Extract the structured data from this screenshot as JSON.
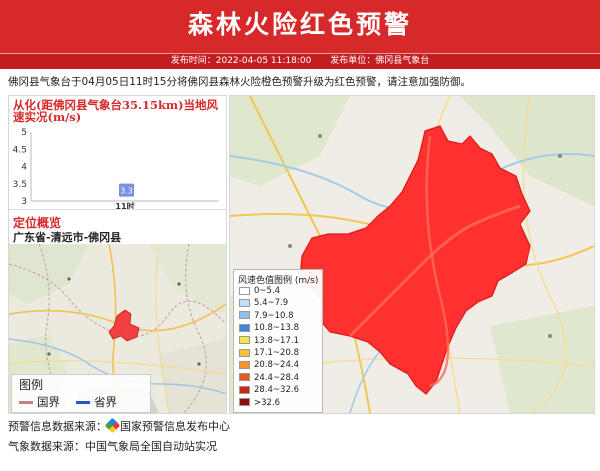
{
  "title": "森林火险红色预警",
  "meta": {
    "publish_time_label": "发布时间：2022-04-05 11:18:00",
    "publisher_label": "发布单位：佛冈县气象台"
  },
  "summary": "佛冈县气象台于04月05日11时15分将佛冈县森林火险橙色预警升级为红色预警，请注意加强防御。",
  "wind_panel": {
    "title": "从化(距佛冈县气象台35.15km)当地风速实况(m/s)"
  },
  "chart_data": {
    "type": "bar",
    "categories": [
      "11时"
    ],
    "values": [
      3.3
    ],
    "data_labels": [
      "3.3"
    ],
    "y_ticks": [
      3,
      3.5,
      4,
      4.5,
      5
    ],
    "y_tick_labels": [
      "3",
      "3.5",
      "4",
      "4.5",
      "5"
    ],
    "ylim": [
      3,
      5
    ],
    "bar_color": "#7b8fe0"
  },
  "location": {
    "title": "定位概览",
    "name": "广东省-清远市-佛冈县"
  },
  "map_legend": {
    "title": "图例",
    "national": "国界",
    "provincial": "省界",
    "national_color": "#c97f8a",
    "provincial_color": "#2356c9"
  },
  "wind_legend": {
    "title": "风速色值图例 (m/s)",
    "items": [
      {
        "label": "0~5.4",
        "color": "#ffffff"
      },
      {
        "label": "5.4~7.9",
        "color": "#c7dcf5"
      },
      {
        "label": "7.9~10.8",
        "color": "#8ec0ef"
      },
      {
        "label": "10.8~13.8",
        "color": "#3f82e0"
      },
      {
        "label": "13.8~17.1",
        "color": "#f8e34a"
      },
      {
        "label": "17.1~20.8",
        "color": "#f6c232"
      },
      {
        "label": "20.8~24.4",
        "color": "#f3962a"
      },
      {
        "label": "24.4~28.4",
        "color": "#e95a22"
      },
      {
        "label": "28.4~32.6",
        "color": "#cf2418"
      },
      {
        "label": ">32.6",
        "color": "#8e0e0e"
      }
    ]
  },
  "footer": {
    "warning_source_label": "预警信息数据来源：",
    "warning_source": "国家预警信息发布中心",
    "weather_source": "气象数据来源：中国气象局全国自动站实况"
  },
  "colors": {
    "header": "#d7282a",
    "alert_region": "#ff3030"
  }
}
